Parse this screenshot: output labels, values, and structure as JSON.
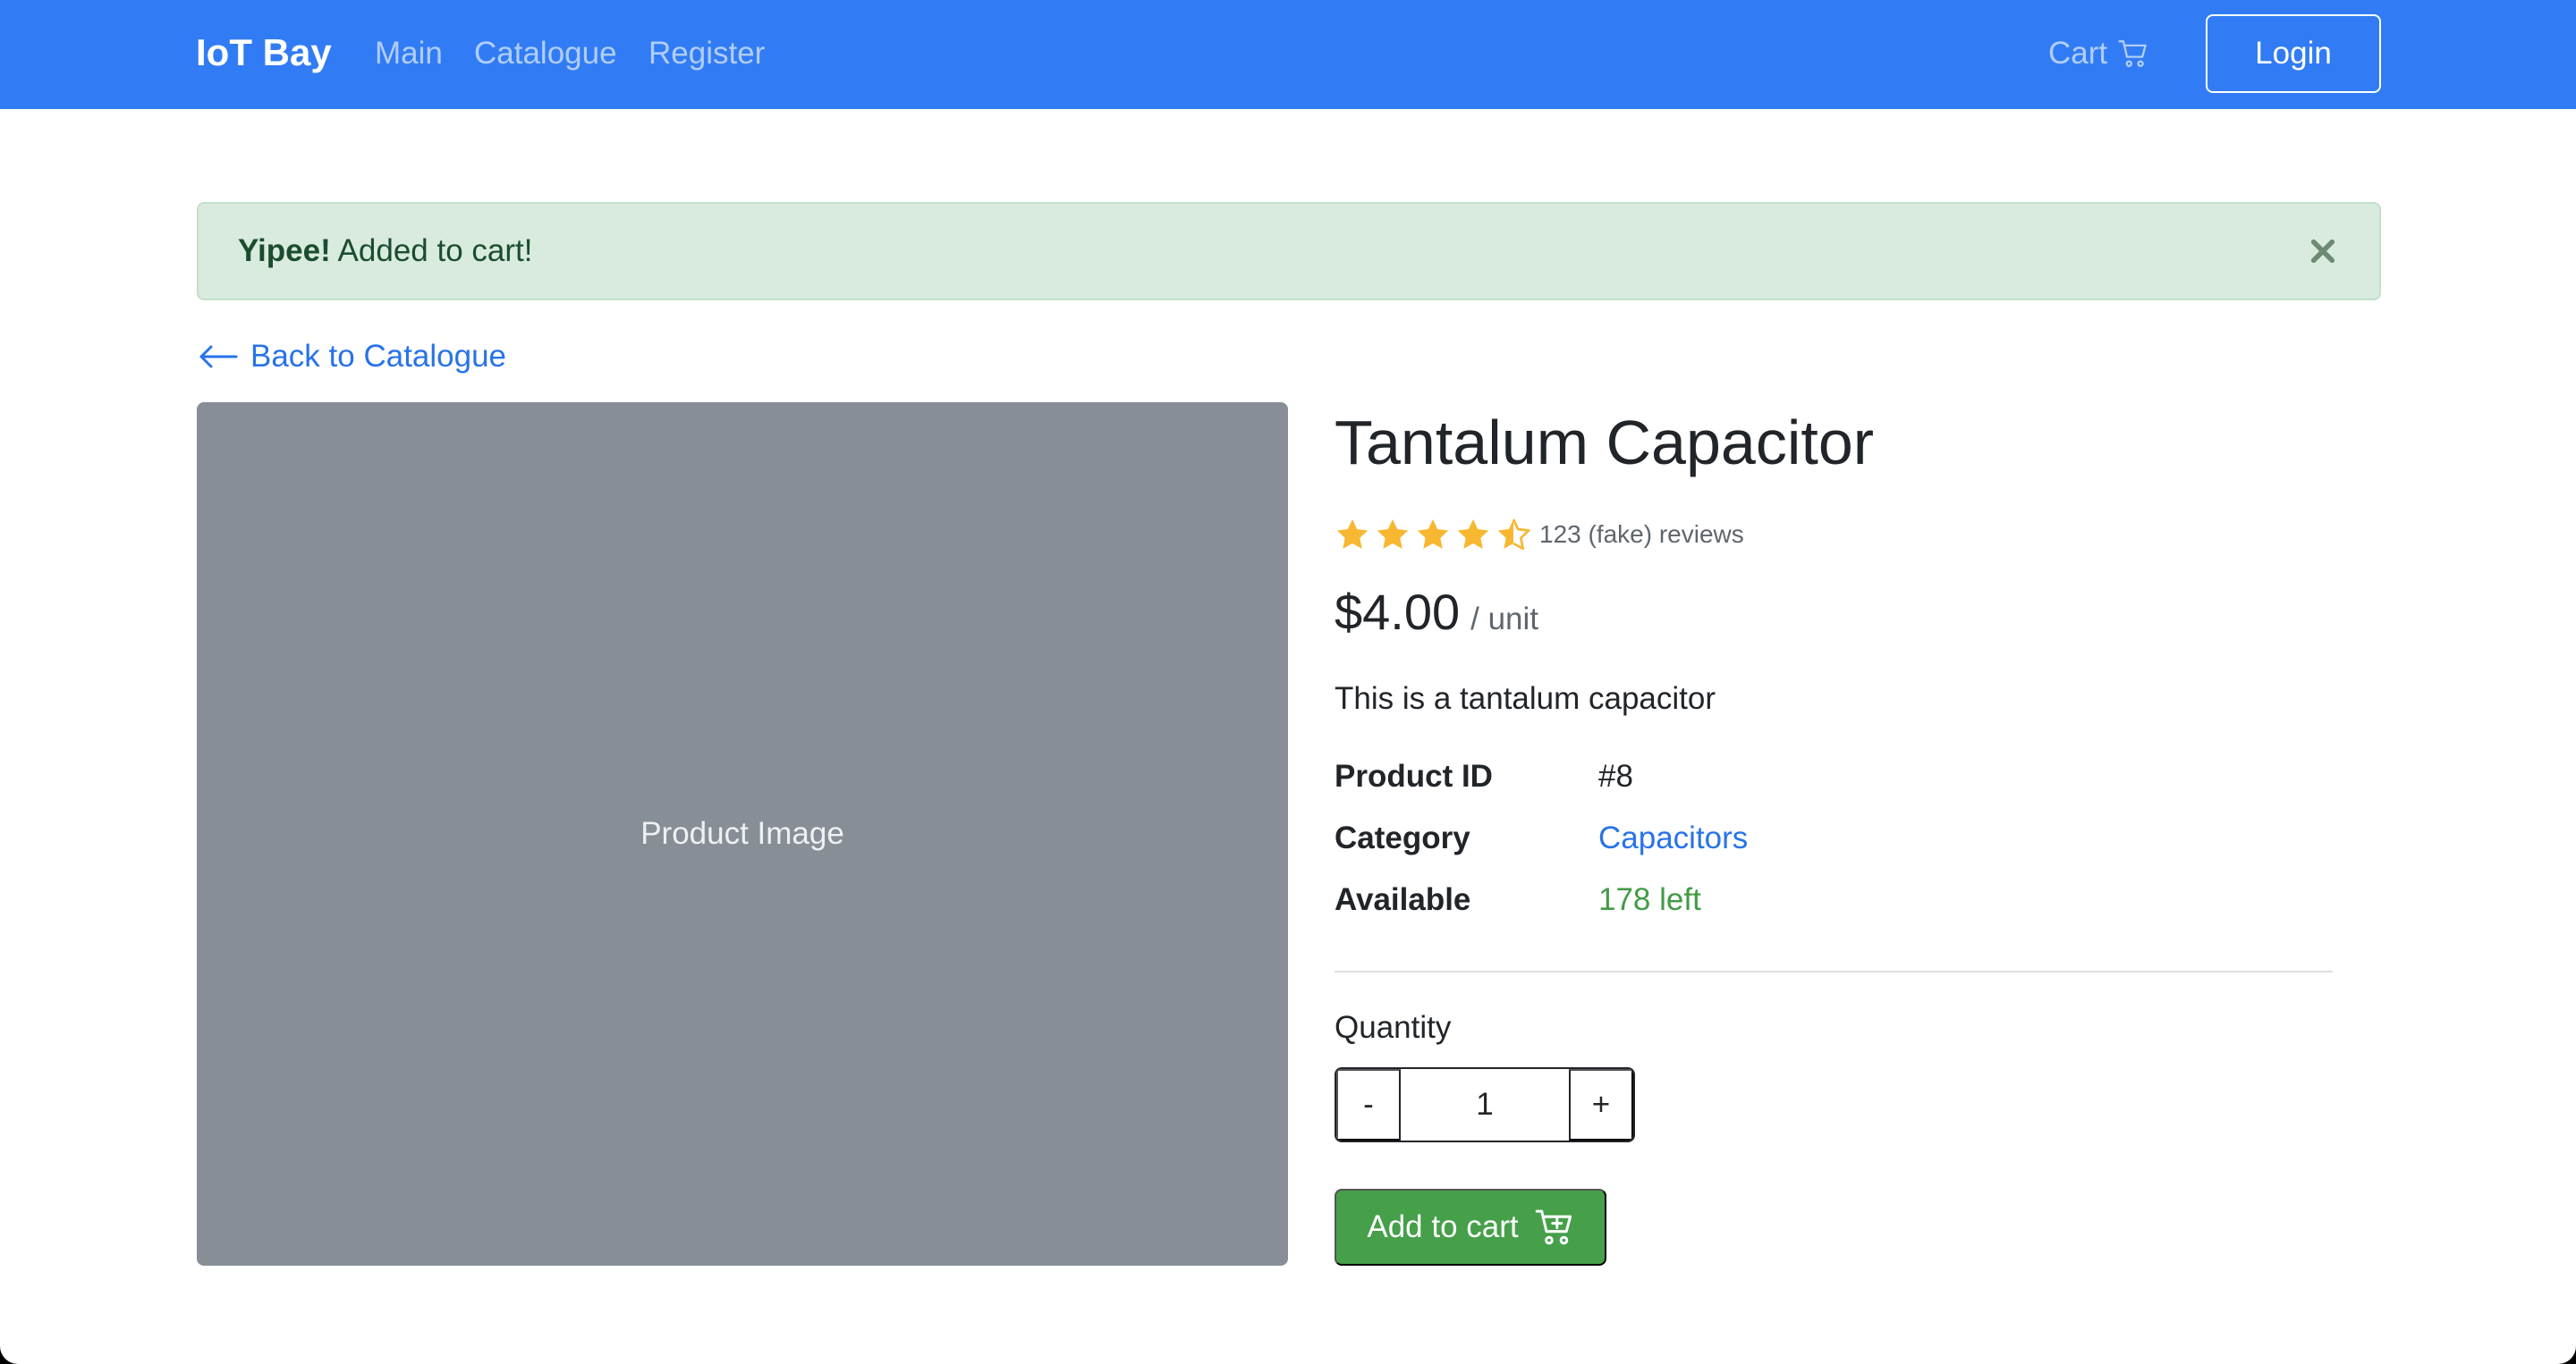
{
  "nav": {
    "brand": "IoT Bay",
    "links": [
      "Main",
      "Catalogue",
      "Register"
    ],
    "cart_label": "Cart",
    "login_label": "Login"
  },
  "alert": {
    "strong": "Yipee!",
    "message": " Added to cart!"
  },
  "back_link": "Back to Catalogue",
  "product": {
    "image_placeholder": "Product Image",
    "title": "Tantalum Capacitor",
    "rating": 4.5,
    "reviews_text": "123 (fake) reviews",
    "price": "$4.00",
    "price_unit": "/ unit",
    "description": "This is a tantalum capacitor",
    "specs": [
      {
        "label": "Product ID",
        "value": "#8"
      },
      {
        "label": "Category",
        "value": "Capacitors"
      },
      {
        "label": "Available",
        "value": "178 left"
      }
    ],
    "quantity_label": "Quantity",
    "quantity_value": "1",
    "minus_label": "-",
    "plus_label": "+",
    "add_to_cart_label": "Add to cart"
  },
  "colors": {
    "navbar": "#317cf4",
    "alert_bg": "#d9ebde",
    "link": "#2873e8",
    "star": "#f7b731",
    "in_stock": "#429b46",
    "add_button": "#45a049",
    "image_placeholder": "#878e96"
  },
  "icons": {
    "cart": "cart-icon",
    "close": "close-icon",
    "back": "arrow-left-icon",
    "star": "star-icon",
    "cart_add": "cart-plus-icon"
  }
}
